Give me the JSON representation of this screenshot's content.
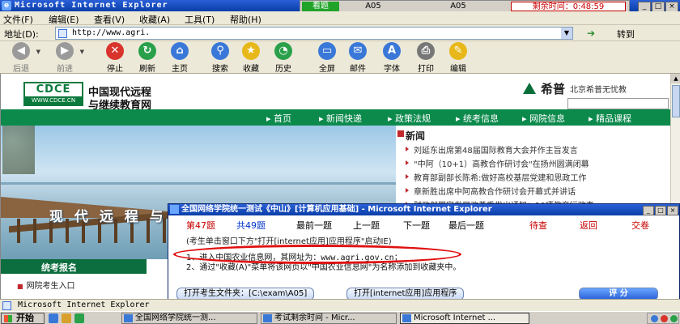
{
  "window": {
    "title": "Microsoft Internet Explorer",
    "controls": [
      "_",
      "□",
      "×"
    ]
  },
  "exam_bar": {
    "seen_label": "看题",
    "cell_a": "A05",
    "cell_b": "A05",
    "time_remaining": "剩余时间：0:48:59"
  },
  "menu": [
    "文件(F)",
    "编辑(E)",
    "查看(V)",
    "收藏(A)",
    "工具(T)",
    "帮助(H)"
  ],
  "address": {
    "label": "地址(D):",
    "url": "http://www.agri.",
    "go_label": "转到"
  },
  "toolbar": [
    {
      "label": "后退",
      "icon": "back-arrow-icon",
      "color": "#2aa04a",
      "enabled": false,
      "glyph": "◀"
    },
    {
      "label": "前进",
      "icon": "forward-arrow-icon",
      "color": "#2aa04a",
      "enabled": false,
      "glyph": "▶"
    },
    {
      "label": "停止",
      "icon": "stop-icon",
      "color": "#d8342c",
      "enabled": true,
      "glyph": "✕"
    },
    {
      "label": "刷新",
      "icon": "refresh-icon",
      "color": "#2aa04a",
      "enabled": true,
      "glyph": "↻"
    },
    {
      "label": "主页",
      "icon": "home-icon",
      "color": "#3a78d8",
      "enabled": true,
      "glyph": "⌂"
    },
    {
      "label": "搜索",
      "icon": "search-icon",
      "color": "#3a78d8",
      "enabled": true,
      "glyph": "⚲"
    },
    {
      "label": "收藏",
      "icon": "favorites-star-icon",
      "color": "#e8b81a",
      "enabled": true,
      "glyph": "★"
    },
    {
      "label": "历史",
      "icon": "history-icon",
      "color": "#2aa04a",
      "enabled": true,
      "glyph": "◔"
    },
    {
      "label": "全屏",
      "icon": "fullscreen-icon",
      "color": "#3a78d8",
      "enabled": true,
      "glyph": "▭"
    },
    {
      "label": "邮件",
      "icon": "mail-icon",
      "color": "#3a78d8",
      "enabled": true,
      "glyph": "✉"
    },
    {
      "label": "字体",
      "icon": "font-icon",
      "color": "#3a78d8",
      "enabled": true,
      "glyph": "A"
    },
    {
      "label": "打印",
      "icon": "print-icon",
      "color": "#777777",
      "enabled": true,
      "glyph": "⎙"
    },
    {
      "label": "编辑",
      "icon": "edit-icon",
      "color": "#e8b81a",
      "enabled": true,
      "glyph": "✎"
    }
  ],
  "site": {
    "logo_big": "CDCE",
    "logo_small": "WWW.CDCE.CN",
    "title_line1": "中国现代远程",
    "title_line2": "与继续教育网",
    "partner_name": "希普",
    "partner_desc": "北京希普无忧教",
    "nav": [
      "首页",
      "新闻快递",
      "政策法规",
      "统考信息",
      "网院信息",
      "精品课程"
    ],
    "hero_slogan": "现 代 远 程 与",
    "news_heading": "新闻",
    "news": [
      "刘延东出席第48届国际教育大会并作主旨发言",
      "\"中阿（10+1）高教合作研讨会\"在扬州圆满闭幕",
      "教育部副部长陈希:做好高校基层党建和思政工作",
      "章新胜出席中阿高教合作研讨会开幕式并讲话",
      "财政部国家发展改革委发出通知：10项教育行政事"
    ],
    "reg_heading": "统考报名",
    "reg_link": "网院考生入口"
  },
  "popup": {
    "title": "全国网络学院统一测试《中山》[计算机应用基础] - Microsoft Internet Explorer",
    "controls": [
      "_",
      "□",
      "×"
    ],
    "current_label": "第47题",
    "total_label": "共49题",
    "nav_buttons": [
      "最前一题",
      "上一题",
      "下一题",
      "最后一题"
    ],
    "pending": "待查",
    "back": "返回",
    "submit": "交卷",
    "prompt": "(考生单击窗口下方\"打开[internet应用]应用程序\"启动IE)",
    "task1_text": "1、进入中国农业信息网，其网址为：",
    "task1_url": "www.agri.gov.cn",
    "task1_end": "；",
    "task2": "2、通过\"收藏(A)\"菜单将该网页以\"中国农业信息网\"为名称添加到收藏夹中。",
    "open_folder_btn": "打开考生文件夹：[C:\\exam\\A05]",
    "open_app_btn": "打开[internet应用]应用程序",
    "score_btn": "评  分"
  },
  "status": {
    "text": "Microsoft Internet Explorer"
  },
  "taskbar": {
    "start": "开始",
    "tasks": [
      "全国网络学院统一测...",
      "考试剩余时间 - Micr...",
      "Microsoft Internet ..."
    ]
  }
}
